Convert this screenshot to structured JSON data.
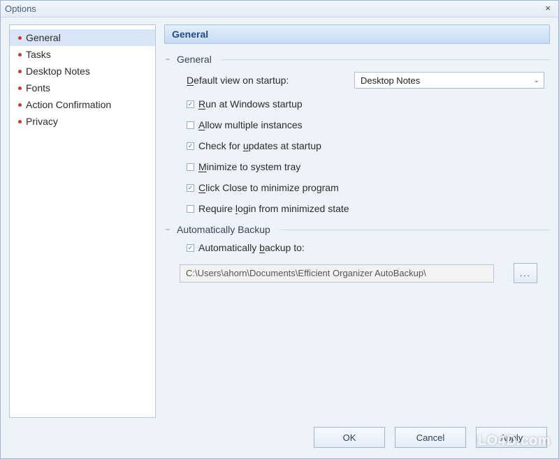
{
  "window": {
    "title": "Options",
    "close_glyph": "×"
  },
  "sidebar": {
    "items": [
      {
        "label": "General",
        "selected": true
      },
      {
        "label": "Tasks",
        "selected": false
      },
      {
        "label": "Desktop Notes",
        "selected": false
      },
      {
        "label": "Fonts",
        "selected": false
      },
      {
        "label": "Action Confirmation",
        "selected": false
      },
      {
        "label": "Privacy",
        "selected": false
      }
    ]
  },
  "main": {
    "header": "General",
    "group_general": {
      "title": "General",
      "default_view_label_pre": "D",
      "default_view_label_post": "efault view on startup:",
      "default_view_value": "Desktop Notes",
      "checkboxes": [
        {
          "checked": true,
          "pre": "",
          "u": "R",
          "post": "un at Windows startup"
        },
        {
          "checked": false,
          "pre": "",
          "u": "A",
          "post": "llow multiple instances"
        },
        {
          "checked": true,
          "pre": "Check for ",
          "u": "u",
          "post": "pdates at startup"
        },
        {
          "checked": false,
          "pre": "",
          "u": "M",
          "post": "inimize to system tray"
        },
        {
          "checked": true,
          "pre": "",
          "u": "C",
          "post": "lick Close to minimize program"
        },
        {
          "checked": false,
          "pre": "Require ",
          "u": "l",
          "post": "ogin from minimized state"
        }
      ]
    },
    "group_backup": {
      "title": "Automatically Backup",
      "chk": {
        "checked": true,
        "pre": "Automatically ",
        "u": "b",
        "post": "ackup to:"
      },
      "path": "C:\\Users\\ahorn\\Documents\\Efficient Organizer AutoBackup\\",
      "browse_label": "..."
    }
  },
  "buttons": {
    "ok": "OK",
    "cancel": "Cancel",
    "apply": "Apply"
  },
  "watermark": "LO4D.com"
}
